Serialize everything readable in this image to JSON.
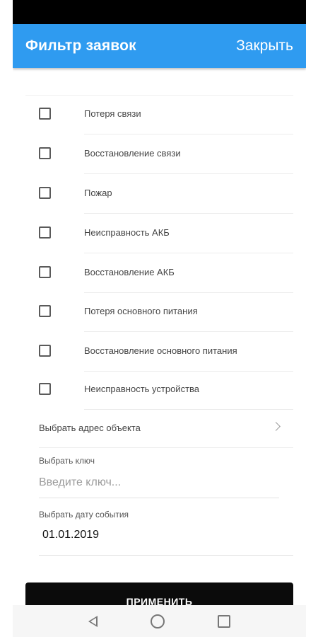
{
  "header": {
    "title": "Фильтр заявок",
    "close_label": "Закрыть"
  },
  "filters": [
    {
      "label": "Потеря связи",
      "checked": false
    },
    {
      "label": "Восстановление связи",
      "checked": false
    },
    {
      "label": "Пожар",
      "checked": false
    },
    {
      "label": "Неисправность АКБ",
      "checked": false
    },
    {
      "label": "Восстановление АКБ",
      "checked": false
    },
    {
      "label": "Потеря основного питания",
      "checked": false
    },
    {
      "label": "Восстановление основного питания",
      "checked": false
    },
    {
      "label": "Неисправность устройства",
      "checked": false
    }
  ],
  "address": {
    "label": "Выбрать адрес объекта"
  },
  "key": {
    "label": "Выбрать ключ",
    "placeholder": "Введите ключ..."
  },
  "date": {
    "label": "Выбрать дату события",
    "value": "01.01.2019"
  },
  "apply_label": "ПРИМЕНИТЬ",
  "colors": {
    "app_bar": "#2f9bf0",
    "button": "#0b0b0b"
  },
  "nav": {
    "back_icon": "back-triangle-icon",
    "home_icon": "home-circle-icon",
    "recent_icon": "recent-square-icon"
  }
}
